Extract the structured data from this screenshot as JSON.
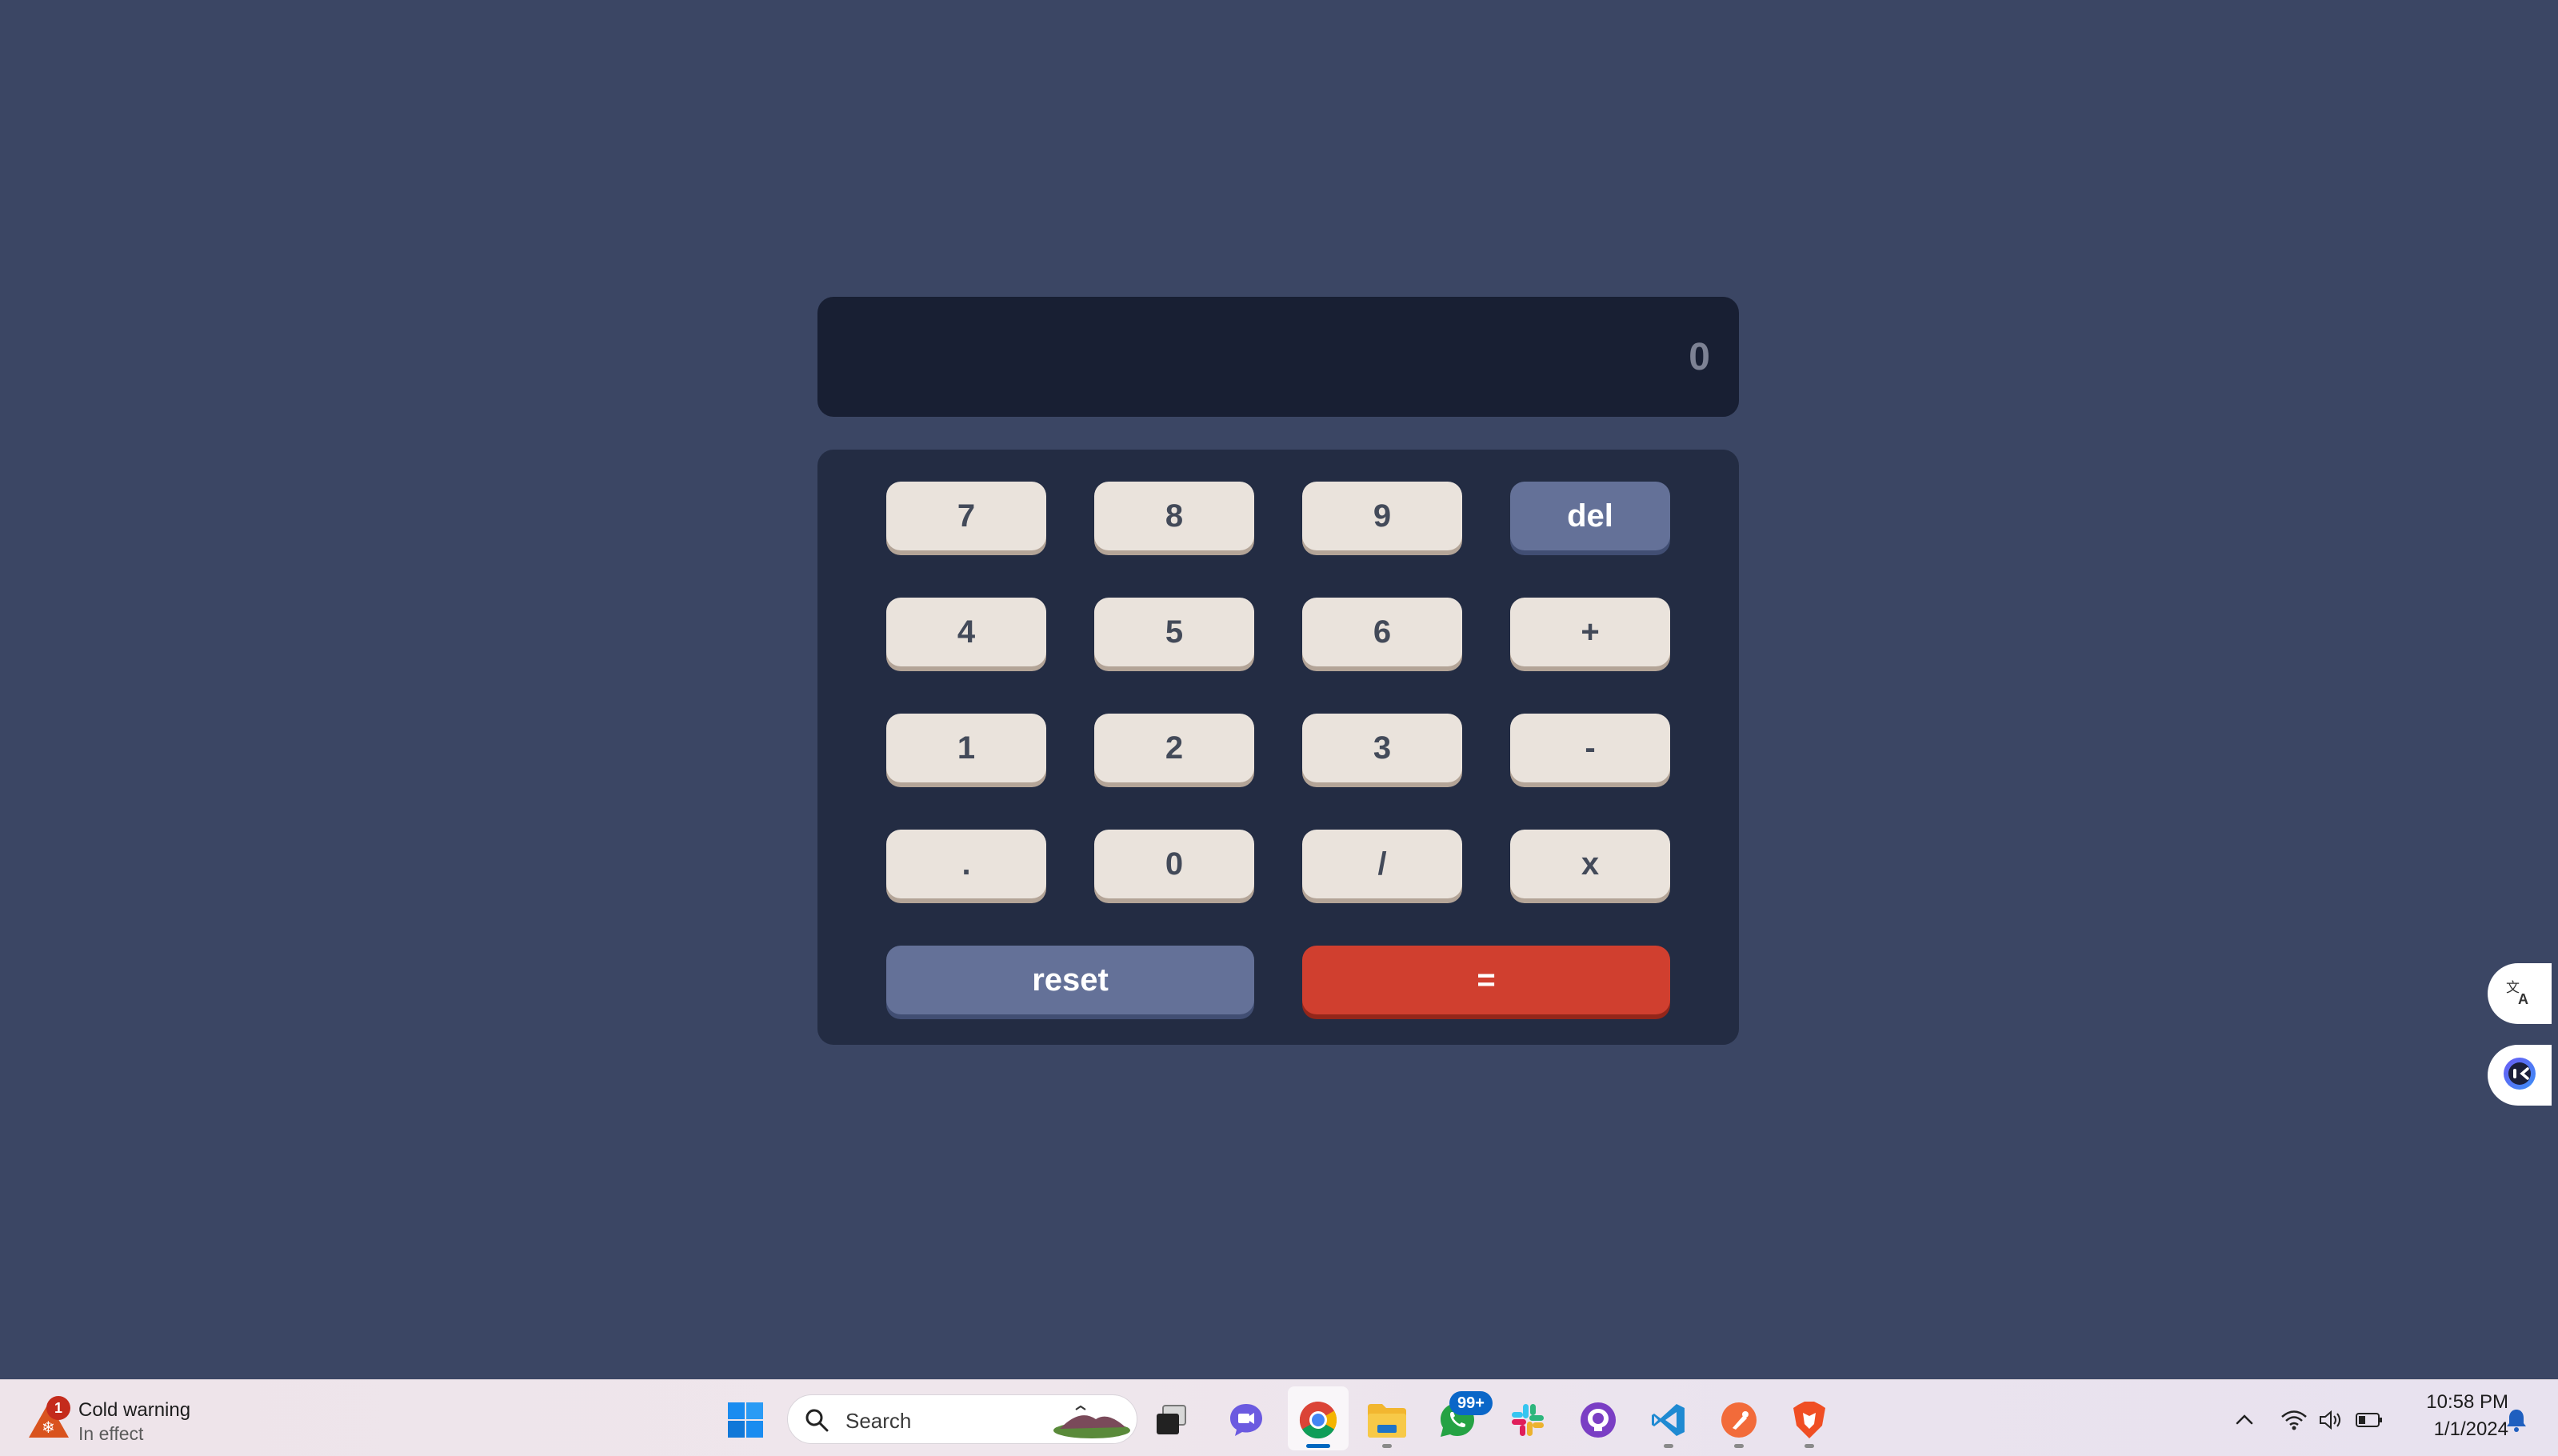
{
  "calculator": {
    "display_value": "0",
    "keys": {
      "k7": "7",
      "k8": "8",
      "k9": "9",
      "del": "del",
      "k4": "4",
      "k5": "5",
      "k6": "6",
      "plus": "+",
      "k1": "1",
      "k2": "2",
      "k3": "3",
      "minus": "-",
      "dot": ".",
      "k0": "0",
      "divide": "/",
      "multiply": "x",
      "reset": "reset",
      "equals": "="
    },
    "colors": {
      "page_bg": "#3b4664",
      "display_bg": "#181f33",
      "keypad_bg": "#232c43",
      "key_bg": "#eae3dc",
      "key_text": "#434a59",
      "accent_blue": "#647198",
      "accent_red": "#d03f2f"
    }
  },
  "side_widgets": {
    "translate_icon": "translate-icon",
    "assistant_icon": "assistant-icon"
  },
  "taskbar": {
    "weather": {
      "title": "Cold warning",
      "subtitle": "In effect",
      "badge": "1"
    },
    "search": {
      "placeholder": "Search"
    },
    "whatsapp_badge": "99+",
    "clock": {
      "time": "10:58 PM",
      "date": "1/1/2024"
    },
    "apps": [
      "start",
      "search",
      "task-view",
      "meet",
      "chrome",
      "file-explorer",
      "whatsapp",
      "slack",
      "github",
      "vscode",
      "postman",
      "brave"
    ]
  }
}
